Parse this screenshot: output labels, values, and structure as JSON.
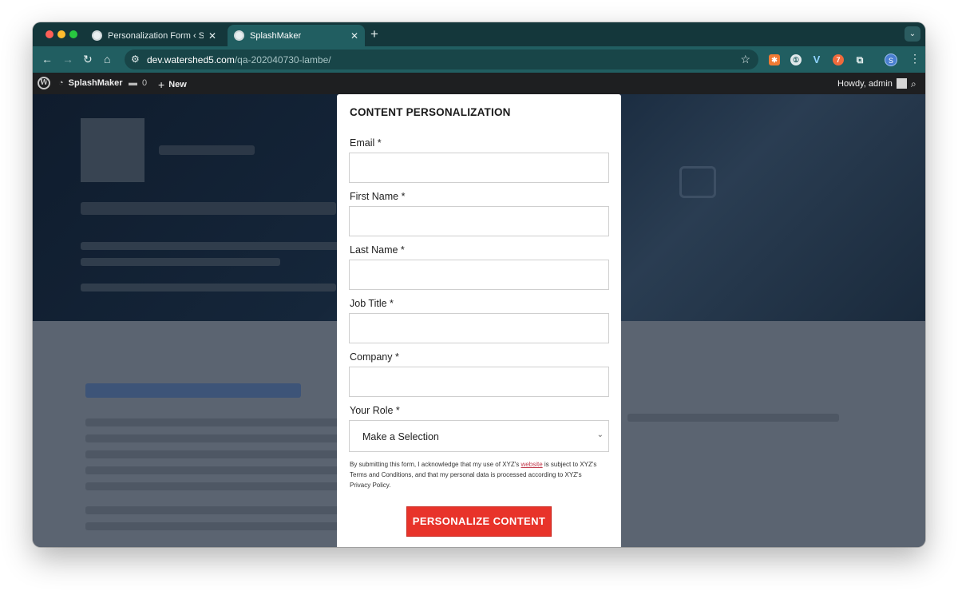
{
  "browser": {
    "tabs": [
      {
        "label": "Personalization Form ‹ Splash",
        "active": false
      },
      {
        "label": "SplashMaker",
        "active": true
      }
    ],
    "url_host": "dev.watershed5.com",
    "url_path": "/qa-202040730-lambe/",
    "profile_initial": "S",
    "colors": {
      "tab_bar": "#14373b",
      "toolbar": "#215e61"
    }
  },
  "admin_bar": {
    "site_name": "SplashMaker",
    "comments_count": "0",
    "new_label": "New",
    "greeting": "Howdy, admin"
  },
  "modal": {
    "title": "CONTENT PERSONALIZATION",
    "fields": [
      {
        "label": "Email *",
        "value": ""
      },
      {
        "label": "First Name *",
        "value": ""
      },
      {
        "label": "Last Name *",
        "value": ""
      },
      {
        "label": "Job Title *",
        "value": ""
      },
      {
        "label": "Company *",
        "value": ""
      }
    ],
    "role": {
      "label": "Your Role *",
      "selected": "Make a Selection"
    },
    "disclaimer": {
      "before_link": "By submitting this form, I acknowledge that my use of XYZ's ",
      "link_text": "website",
      "after_link": " is subject to XYZ's Terms and Conditions, and that my personal data is processed according to XYZ's Privacy Policy."
    },
    "submit_label": "PERSONALIZE CONTENT",
    "colors": {
      "submit": "#e8332a",
      "link": "#c0394b"
    }
  }
}
